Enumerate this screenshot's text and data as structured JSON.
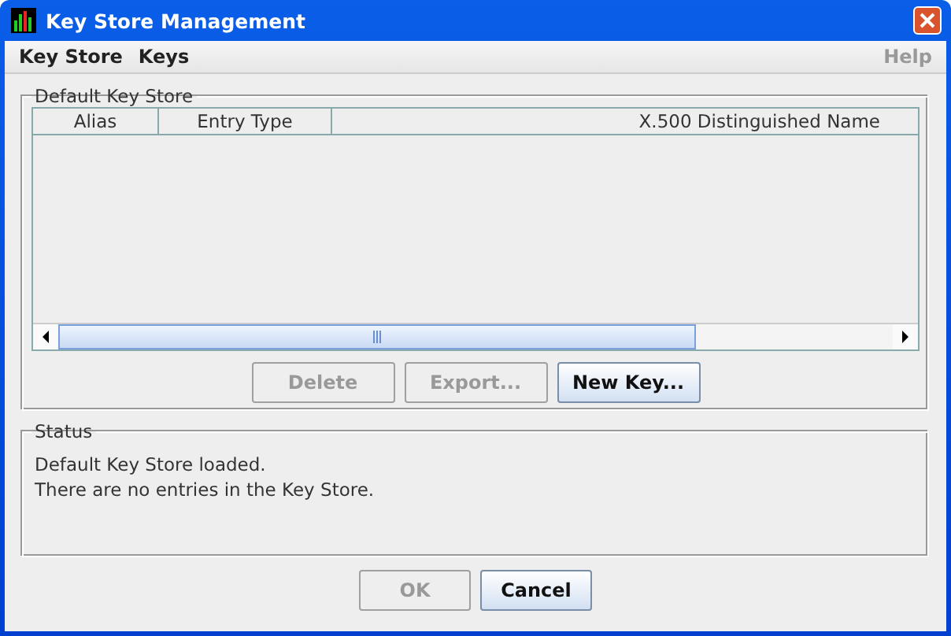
{
  "window": {
    "title": "Key Store Management"
  },
  "menu": [
    {
      "label": "Key Store",
      "disabled": false
    },
    {
      "label": "Keys",
      "disabled": false
    }
  ],
  "help_menu": {
    "label": "Help",
    "disabled": true
  },
  "key_store_panel": {
    "title": "Default Key Store",
    "table": {
      "columns": [
        "Alias",
        "Entry Type",
        "X.500 Distinguished Name"
      ]
    },
    "buttons": [
      {
        "label": "Delete",
        "disabled": true
      },
      {
        "label": "Export...",
        "disabled": true
      },
      {
        "label": "New Key...",
        "disabled": false
      }
    ]
  },
  "status_panel": {
    "title": "Status",
    "lines": [
      "Default Key Store loaded.",
      "There are no entries in the Key Store."
    ]
  },
  "buttons": [
    {
      "label": "OK",
      "disabled": true
    },
    {
      "label": "Cancel",
      "disabled": false
    }
  ]
}
